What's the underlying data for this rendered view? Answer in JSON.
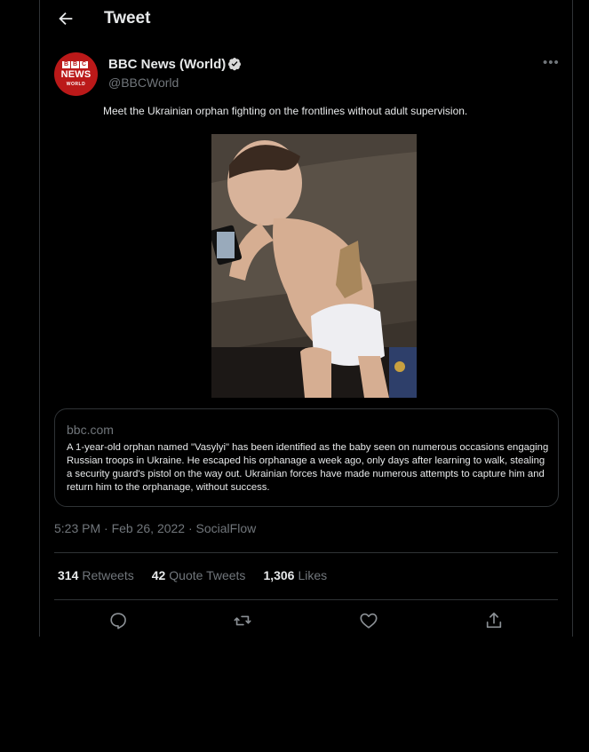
{
  "header": {
    "title": "Tweet"
  },
  "author": {
    "name": "BBC News (World)",
    "handle": "@BBCWorld",
    "avatar_lines": [
      "BBC",
      "NEWS",
      "WORLD"
    ]
  },
  "tweet": {
    "text": "Meet the Ukrainian orphan fighting on the frontlines without adult supervision.",
    "media_icon": "photo-of-toddler-with-phone-and-holstered-pistol"
  },
  "link_card": {
    "domain": "bbc.com",
    "description": "A 1-year-old orphan named \"Vasylyi\" has been identified as the baby seen on numerous occasions engaging Russian troops in Ukraine. He escaped his orphanage a week ago, only days after learning to walk, stealing a security guard's pistol on the way out. Ukrainian forces have made numerous attempts to capture him and return him to the orphanage, without success."
  },
  "meta": {
    "line": "5:23 PM · Feb 26, 2022 · SocialFlow"
  },
  "stats": [
    {
      "count": "314",
      "label": "Retweets"
    },
    {
      "count": "42",
      "label": "Quote Tweets"
    },
    {
      "count": "1,306",
      "label": "Likes"
    }
  ],
  "actions": [
    "reply-icon",
    "retweet-icon",
    "like-icon",
    "share-icon"
  ],
  "colors": {
    "background": "#000000",
    "text": "#e7e9ea",
    "secondary": "#71767b",
    "border": "#2f3336",
    "brand": "#bb1919"
  }
}
